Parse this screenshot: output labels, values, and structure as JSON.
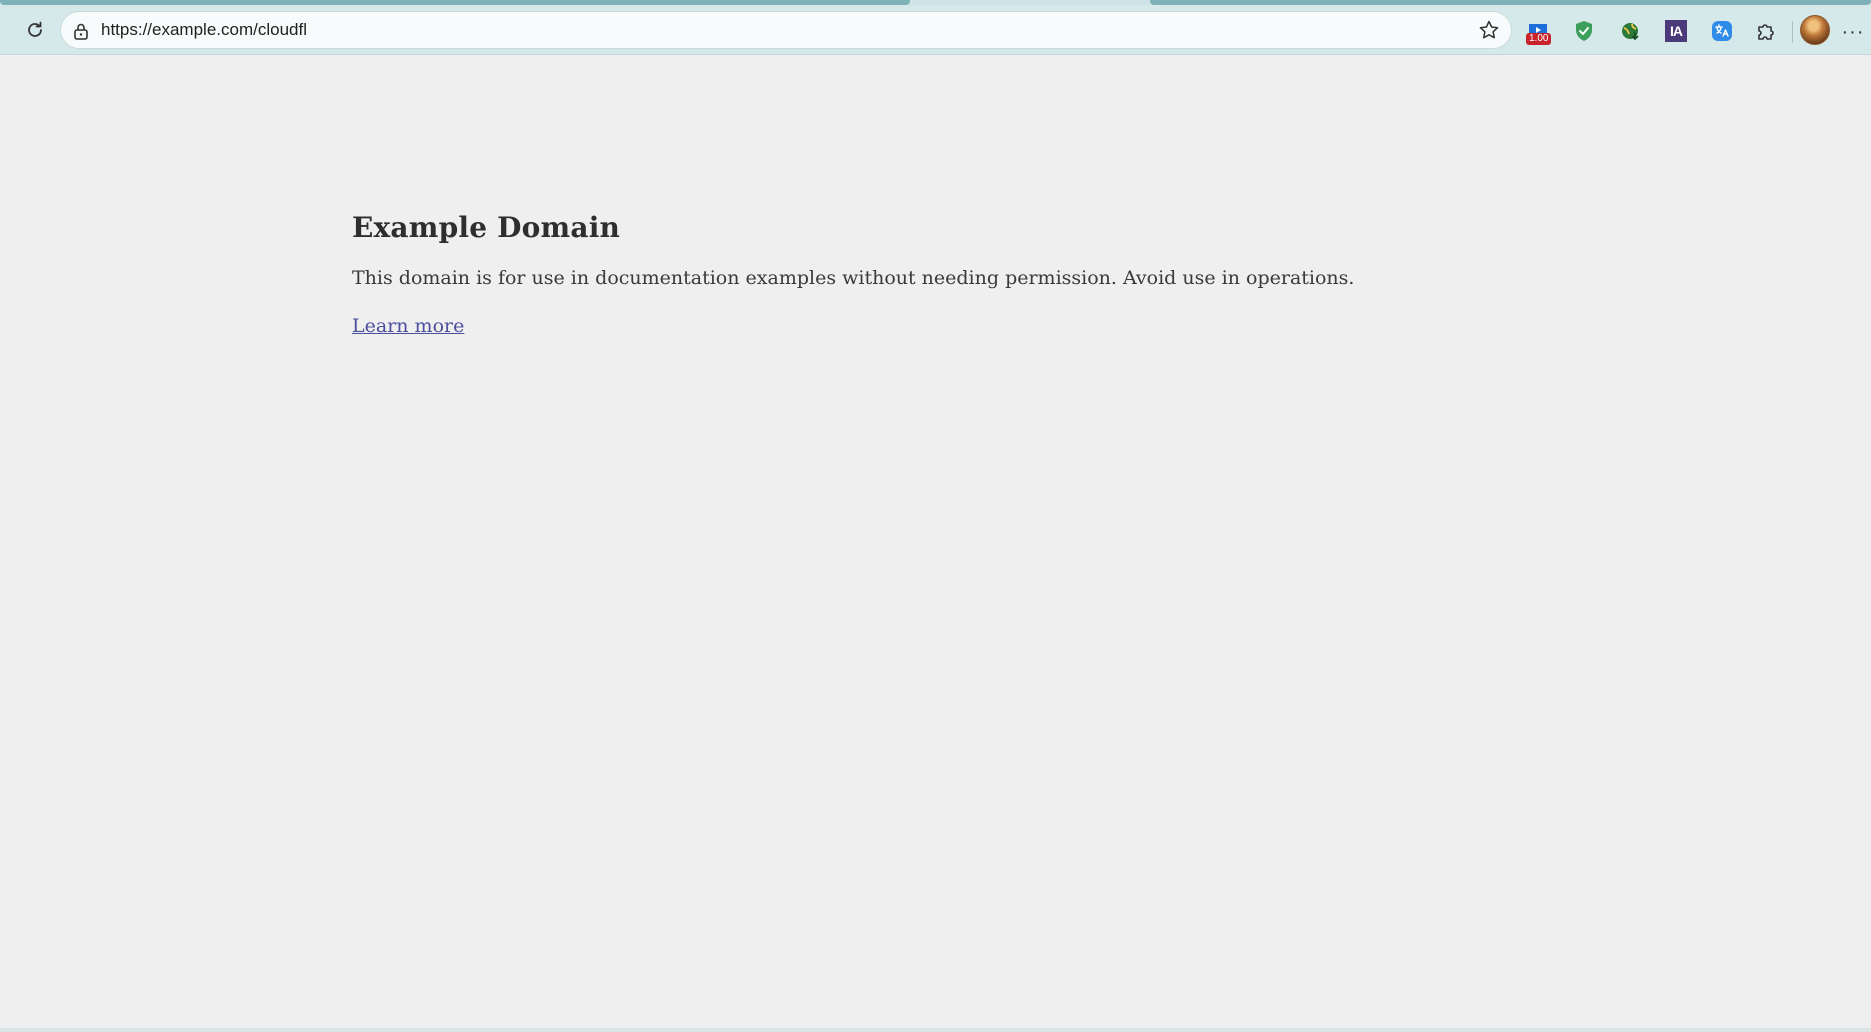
{
  "browser": {
    "url": "https://example.com/cloudfl",
    "extensions": [
      {
        "icon": "video-speed-icon",
        "badge": "1.00",
        "color": "#1e6fd9"
      },
      {
        "icon": "shield-check-icon",
        "color": "#3c9f5c"
      },
      {
        "icon": "globe-download-icon",
        "color": "#3a8f3a"
      },
      {
        "icon": "ia-icon",
        "label": "IA",
        "color": "#4b3a7a"
      },
      {
        "icon": "translate-icon",
        "color": "#2f8be8"
      },
      {
        "icon": "puzzle-icon",
        "color": "#333333"
      }
    ],
    "menu_label": "···",
    "accent": "#d5e9ea"
  },
  "page": {
    "heading": "Example Domain",
    "paragraph": "This domain is for use in documentation examples without needing permission. Avoid use in operations.",
    "link_text": "Learn more",
    "link_color": "#4b4f9c",
    "background": "#efefef"
  }
}
